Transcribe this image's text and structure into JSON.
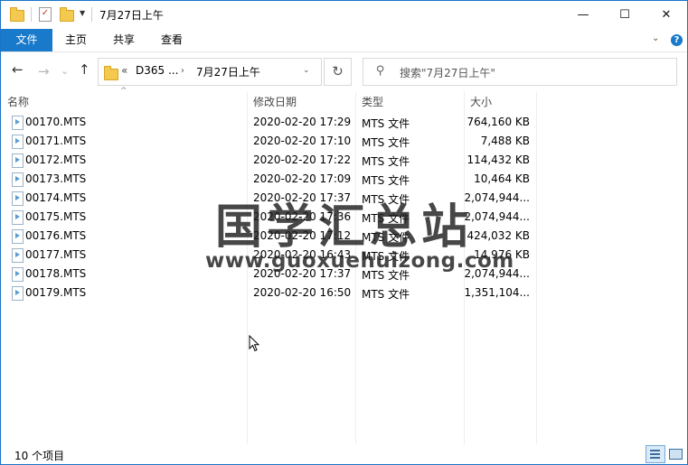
{
  "window": {
    "title": "7月27日上午",
    "controls": {
      "minimize": "—",
      "maximize": "☐",
      "close": "✕"
    }
  },
  "ribbon": {
    "tabs": [
      "文件",
      "主页",
      "共享",
      "查看"
    ],
    "help": "?"
  },
  "address": {
    "overflow": "«",
    "crumbs": [
      "D365 ...",
      "7月27日上午"
    ]
  },
  "search": {
    "placeholder": "搜索\"7月27日上午\""
  },
  "columns": {
    "name": "名称",
    "date": "修改日期",
    "type": "类型",
    "size": "大小"
  },
  "files": [
    {
      "name": "00170.MTS",
      "date": "2020-02-20 17:29",
      "type": "MTS 文件",
      "size": "764,160 KB"
    },
    {
      "name": "00171.MTS",
      "date": "2020-02-20 17:10",
      "type": "MTS 文件",
      "size": "7,488 KB"
    },
    {
      "name": "00172.MTS",
      "date": "2020-02-20 17:22",
      "type": "MTS 文件",
      "size": "114,432 KB"
    },
    {
      "name": "00173.MTS",
      "date": "2020-02-20 17:09",
      "type": "MTS 文件",
      "size": "10,464 KB"
    },
    {
      "name": "00174.MTS",
      "date": "2020-02-20 17:37",
      "type": "MTS 文件",
      "size": "2,074,944..."
    },
    {
      "name": "00175.MTS",
      "date": "2020-02-20 17:36",
      "type": "MTS 文件",
      "size": "2,074,944..."
    },
    {
      "name": "00176.MTS",
      "date": "2020-02-20 17:12",
      "type": "MTS 文件",
      "size": "424,032 KB"
    },
    {
      "name": "00177.MTS",
      "date": "2020-02-20 16:43",
      "type": "MTS 文件",
      "size": "14,976 KB"
    },
    {
      "name": "00178.MTS",
      "date": "2020-02-20 17:37",
      "type": "MTS 文件",
      "size": "2,074,944..."
    },
    {
      "name": "00179.MTS",
      "date": "2020-02-20 16:50",
      "type": "MTS 文件",
      "size": "1,351,104..."
    }
  ],
  "status": {
    "count": "10 个项目"
  },
  "watermark": {
    "line1": "国学汇总站",
    "line2": "www.guoxuehuizong.com"
  }
}
